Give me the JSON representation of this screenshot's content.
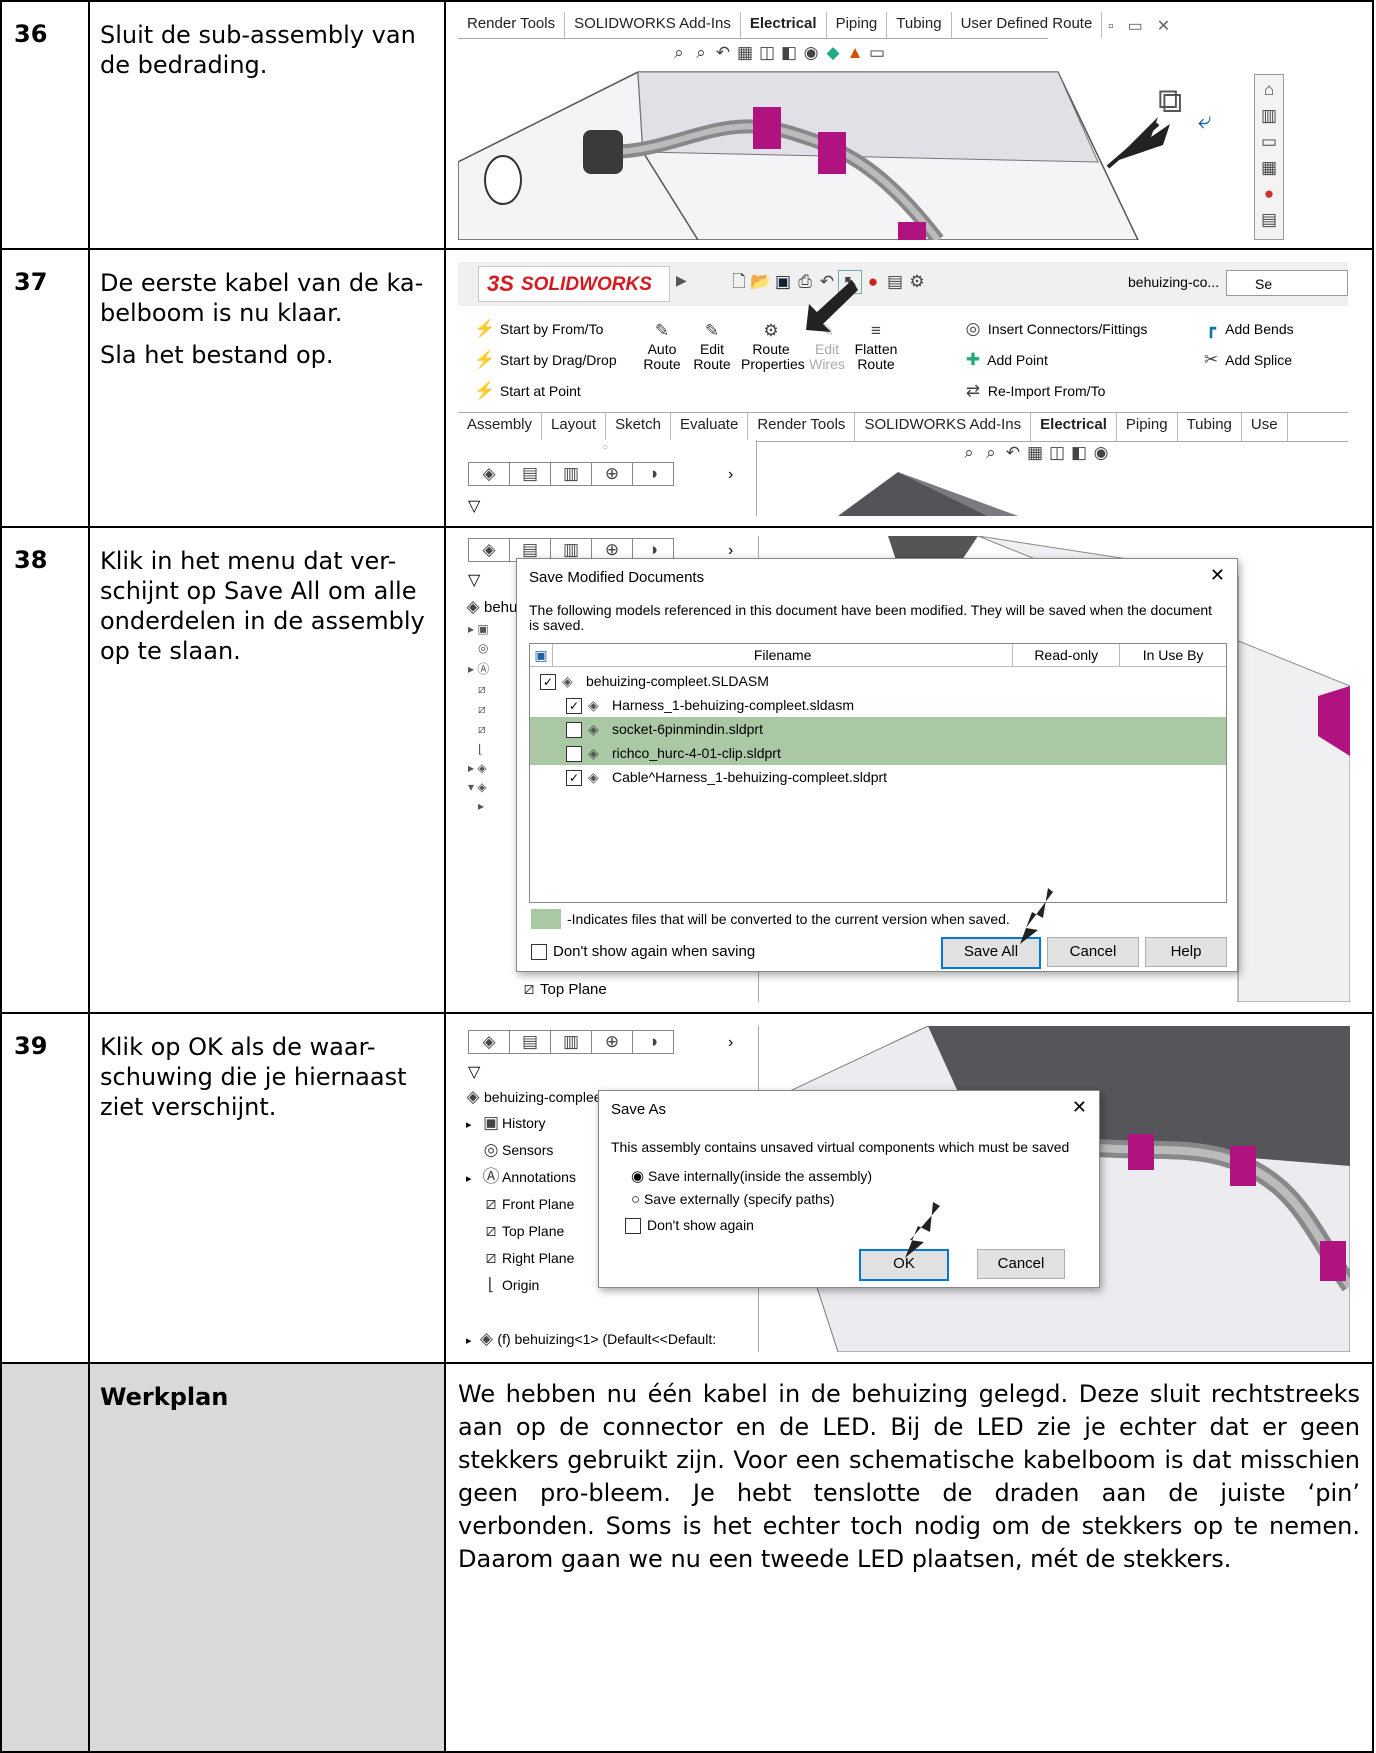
{
  "steps": [
    {
      "num": "36",
      "text": [
        "Sluit de sub-assembly van de bedrading."
      ]
    },
    {
      "num": "37",
      "text": [
        "De eerste kabel van de ka-belboom is nu klaar.",
        "Sla het bestand op."
      ]
    },
    {
      "num": "38",
      "text": [
        "Klik in het menu dat ver-schijnt op Save All om alle onderdelen in de assembly op te slaan."
      ]
    },
    {
      "num": "39",
      "text": [
        "Klik op OK als de waar-schuwing die je hiernaast ziet verschijnt."
      ]
    }
  ],
  "werkplan": {
    "label": "Werkplan",
    "text": "We hebben nu één kabel in de behuizing gelegd. Deze sluit rechtstreeks aan op de connector en de LED. Bij de LED zie je echter dat er geen stekkers gebruikt zijn. Voor een schematische kabelboom is dat misschien geen pro-bleem. Je hebt tenslotte de draden aan de juiste ‘pin’ verbonden. Soms is het echter toch nodig om de stekkers op te nemen. Daarom gaan we nu een tweede LED plaatsen, mét de stekkers."
  },
  "shot36": {
    "tabs": [
      "Render Tools",
      "SOLIDWORKS Add-Ins",
      "Electrical",
      "Piping",
      "Tubing",
      "User Defined Route"
    ],
    "active_tab": "Electrical"
  },
  "shot37": {
    "brand": "SOLIDWORKS",
    "brand_prefix": "3S",
    "filename": "behuizing-co...",
    "search": "Se",
    "cmds_left": [
      "Start by From/To",
      "Start by Drag/Drop",
      "Start at Point"
    ],
    "cmds_mid": [
      {
        "l1": "Auto",
        "l2": "Route"
      },
      {
        "l1": "Edit",
        "l2": "Route"
      },
      {
        "l1": "Route",
        "l2": "Properties"
      },
      {
        "l1": "Edit",
        "l2": "Wires"
      },
      {
        "l1": "Flatten",
        "l2": "Route"
      }
    ],
    "cmds_right": [
      "Insert Connectors/Fittings",
      "Add Point",
      "Re-Import From/To"
    ],
    "cmds_far": [
      "Add Bends",
      "Add Splice"
    ],
    "tabs": [
      "Assembly",
      "Layout",
      "Sketch",
      "Evaluate",
      "Render Tools",
      "SOLIDWORKS Add-Ins",
      "Electrical",
      "Piping",
      "Tubing",
      "Use"
    ],
    "active_tab": "Electrical"
  },
  "shot38": {
    "title": "Save Modified Documents",
    "message": "The following models referenced in this document have been modified. They will be saved when the document is saved.",
    "col_filename": "Filename",
    "col_readonly": "Read-only",
    "col_inuse": "In Use By",
    "files": [
      {
        "name": "behuizing-compleet.SLDASM",
        "checked": true,
        "indent": 0,
        "green": false
      },
      {
        "name": "Harness_1-behuizing-compleet.sldasm",
        "checked": true,
        "indent": 1,
        "green": false
      },
      {
        "name": "socket-6pinmindin.sldprt",
        "checked": false,
        "indent": 1,
        "green": true
      },
      {
        "name": "richco_hurc-4-01-clip.sldprt",
        "checked": false,
        "indent": 1,
        "green": true
      },
      {
        "name": "Cable^Harness_1-behuizing-compleet.sldprt",
        "checked": true,
        "indent": 1,
        "green": false
      }
    ],
    "legend": "-Indicates files that will be converted to the current version when saved.",
    "dont_show": "Don't show again when saving",
    "btn_saveall": "Save All",
    "btn_cancel": "Cancel",
    "btn_help": "Help",
    "tree_behind": "behu",
    "tree_bottom": "Top Plane"
  },
  "shot39": {
    "tree_root": "behuizing-compleet  (Default<Display St",
    "tree": [
      "History",
      "Sensors",
      "Annotations",
      "Front Plane",
      "Top Plane",
      "Right Plane",
      "Origin"
    ],
    "tree_last": "(f) behuizing<1> (Default<<Default:",
    "title": "Save As",
    "message": "This assembly contains unsaved virtual components which must be saved",
    "opt1": "Save internally(inside the assembly)",
    "opt2": "Save externally (specify paths)",
    "dont_show": "Don't show again",
    "btn_ok": "OK",
    "btn_cancel": "Cancel"
  },
  "colors": {
    "green_row": "#a9c8a3",
    "accent": "#0078d7",
    "magenta": "#b0127f",
    "brand_red": "#d71920"
  }
}
